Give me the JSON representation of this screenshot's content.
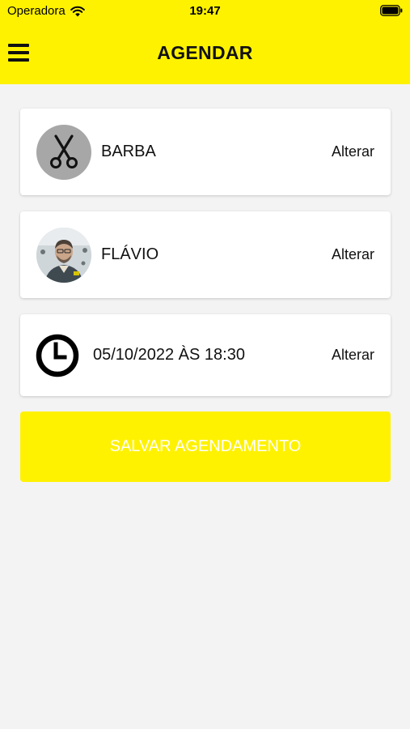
{
  "status_bar": {
    "carrier": "Operadora",
    "time": "19:47"
  },
  "header": {
    "title": "AGENDAR",
    "menu_icon": "hamburger-menu-icon"
  },
  "cards": {
    "service": {
      "label": "BARBA",
      "action": "Alterar",
      "icon": "scissors-icon"
    },
    "professional": {
      "label": "FLÁVIO",
      "action": "Alterar",
      "icon": "profile-photo"
    },
    "datetime": {
      "label": "05/10/2022 ÀS 18:30",
      "action": "Alterar",
      "icon": "clock-icon"
    }
  },
  "save_button": {
    "label": "SALVAR AGENDAMENTO"
  },
  "colors": {
    "accent_yellow": "#fff200",
    "background": "#f3f3f3",
    "card": "#ffffff",
    "avatar_gray": "#a7a7a7"
  }
}
